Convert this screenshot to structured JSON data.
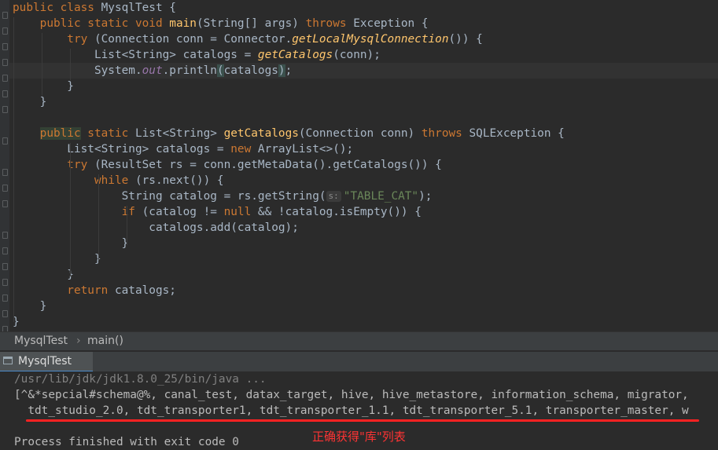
{
  "editor": {
    "lines": [
      [
        [
          "public class ",
          "kw"
        ],
        [
          "MysqlTest ",
          ""
        ],
        [
          "{",
          ""
        ]
      ],
      [
        [
          "    public static void ",
          "kw"
        ],
        [
          "main",
          "fn"
        ],
        [
          "(String[] args) ",
          ""
        ],
        [
          "throws ",
          "kw"
        ],
        [
          "Exception {",
          ""
        ]
      ],
      [
        [
          "        try ",
          "kw"
        ],
        [
          "(Connection conn = Connector.",
          ""
        ],
        [
          "getLocalMysqlConnection",
          "it"
        ],
        [
          "()) {",
          ""
        ]
      ],
      [
        [
          "            List<String> catalogs = ",
          ""
        ],
        [
          "getCatalogs",
          "it"
        ],
        [
          "(conn);",
          ""
        ]
      ],
      [
        [
          "            System.",
          ""
        ],
        [
          "out",
          "fld"
        ],
        [
          ".println",
          ""
        ],
        [
          "(",
          "brh"
        ],
        [
          "catalogs",
          ""
        ],
        [
          ")",
          "brh"
        ],
        [
          ";",
          ""
        ]
      ],
      [
        [
          "        }",
          ""
        ]
      ],
      [
        [
          "    }",
          ""
        ]
      ],
      [
        [
          "",
          ""
        ]
      ],
      [
        [
          "    ",
          ""
        ],
        [
          "public",
          "pub"
        ],
        [
          " static ",
          "kw"
        ],
        [
          "List<String> ",
          ""
        ],
        [
          "getCatalogs",
          "fn"
        ],
        [
          "(Connection conn) ",
          ""
        ],
        [
          "throws ",
          "kw"
        ],
        [
          "SQLException {",
          ""
        ]
      ],
      [
        [
          "        List<String> catalogs = ",
          ""
        ],
        [
          "new ",
          "kw"
        ],
        [
          "ArrayList<>();",
          ""
        ]
      ],
      [
        [
          "        try ",
          "kw"
        ],
        [
          "(ResultSet rs = conn.getMetaData().getCatalogs()) {",
          ""
        ]
      ],
      [
        [
          "            while ",
          "kw"
        ],
        [
          "(rs.next()) {",
          ""
        ]
      ],
      [
        [
          "                String catalog = rs.getString(",
          ""
        ],
        [
          "s:",
          "hint"
        ],
        [
          "\"TABLE_CAT\"",
          "str"
        ],
        [
          ");",
          ""
        ]
      ],
      [
        [
          "                if ",
          "kw"
        ],
        [
          "(catalog != ",
          ""
        ],
        [
          "null ",
          "kw"
        ],
        [
          "&& !catalog.isEmpty()) {",
          ""
        ]
      ],
      [
        [
          "                    catalogs.add(catalog);",
          ""
        ]
      ],
      [
        [
          "                }",
          ""
        ]
      ],
      [
        [
          "            }",
          ""
        ]
      ],
      [
        [
          "        }",
          ""
        ]
      ],
      [
        [
          "        return ",
          "kw"
        ],
        [
          "catalogs;",
          ""
        ]
      ],
      [
        [
          "    }",
          ""
        ]
      ],
      [
        [
          "}",
          ""
        ]
      ]
    ]
  },
  "breadcrumb": {
    "class_name": "MysqlTest",
    "separator": "›",
    "method_name": "main()"
  },
  "run_panel": {
    "tab_label": "MysqlTest"
  },
  "console": {
    "command": "/usr/lib/jdk/jdk1.8.0_25/bin/java ...",
    "output_line1": "[^&*sepcial#schema@%, canal_test, datax_target, hive, hive_metastore, information_schema, migrator, ",
    "output_line2": "  tdt_studio_2.0, tdt_transporter1, tdt_transporter_1.1, tdt_transporter_5.1, transporter_master, w",
    "exit_message": "Process finished with exit code 0"
  },
  "annotation": {
    "text": "正确获得\"库\"列表",
    "color": "#ff2222"
  }
}
